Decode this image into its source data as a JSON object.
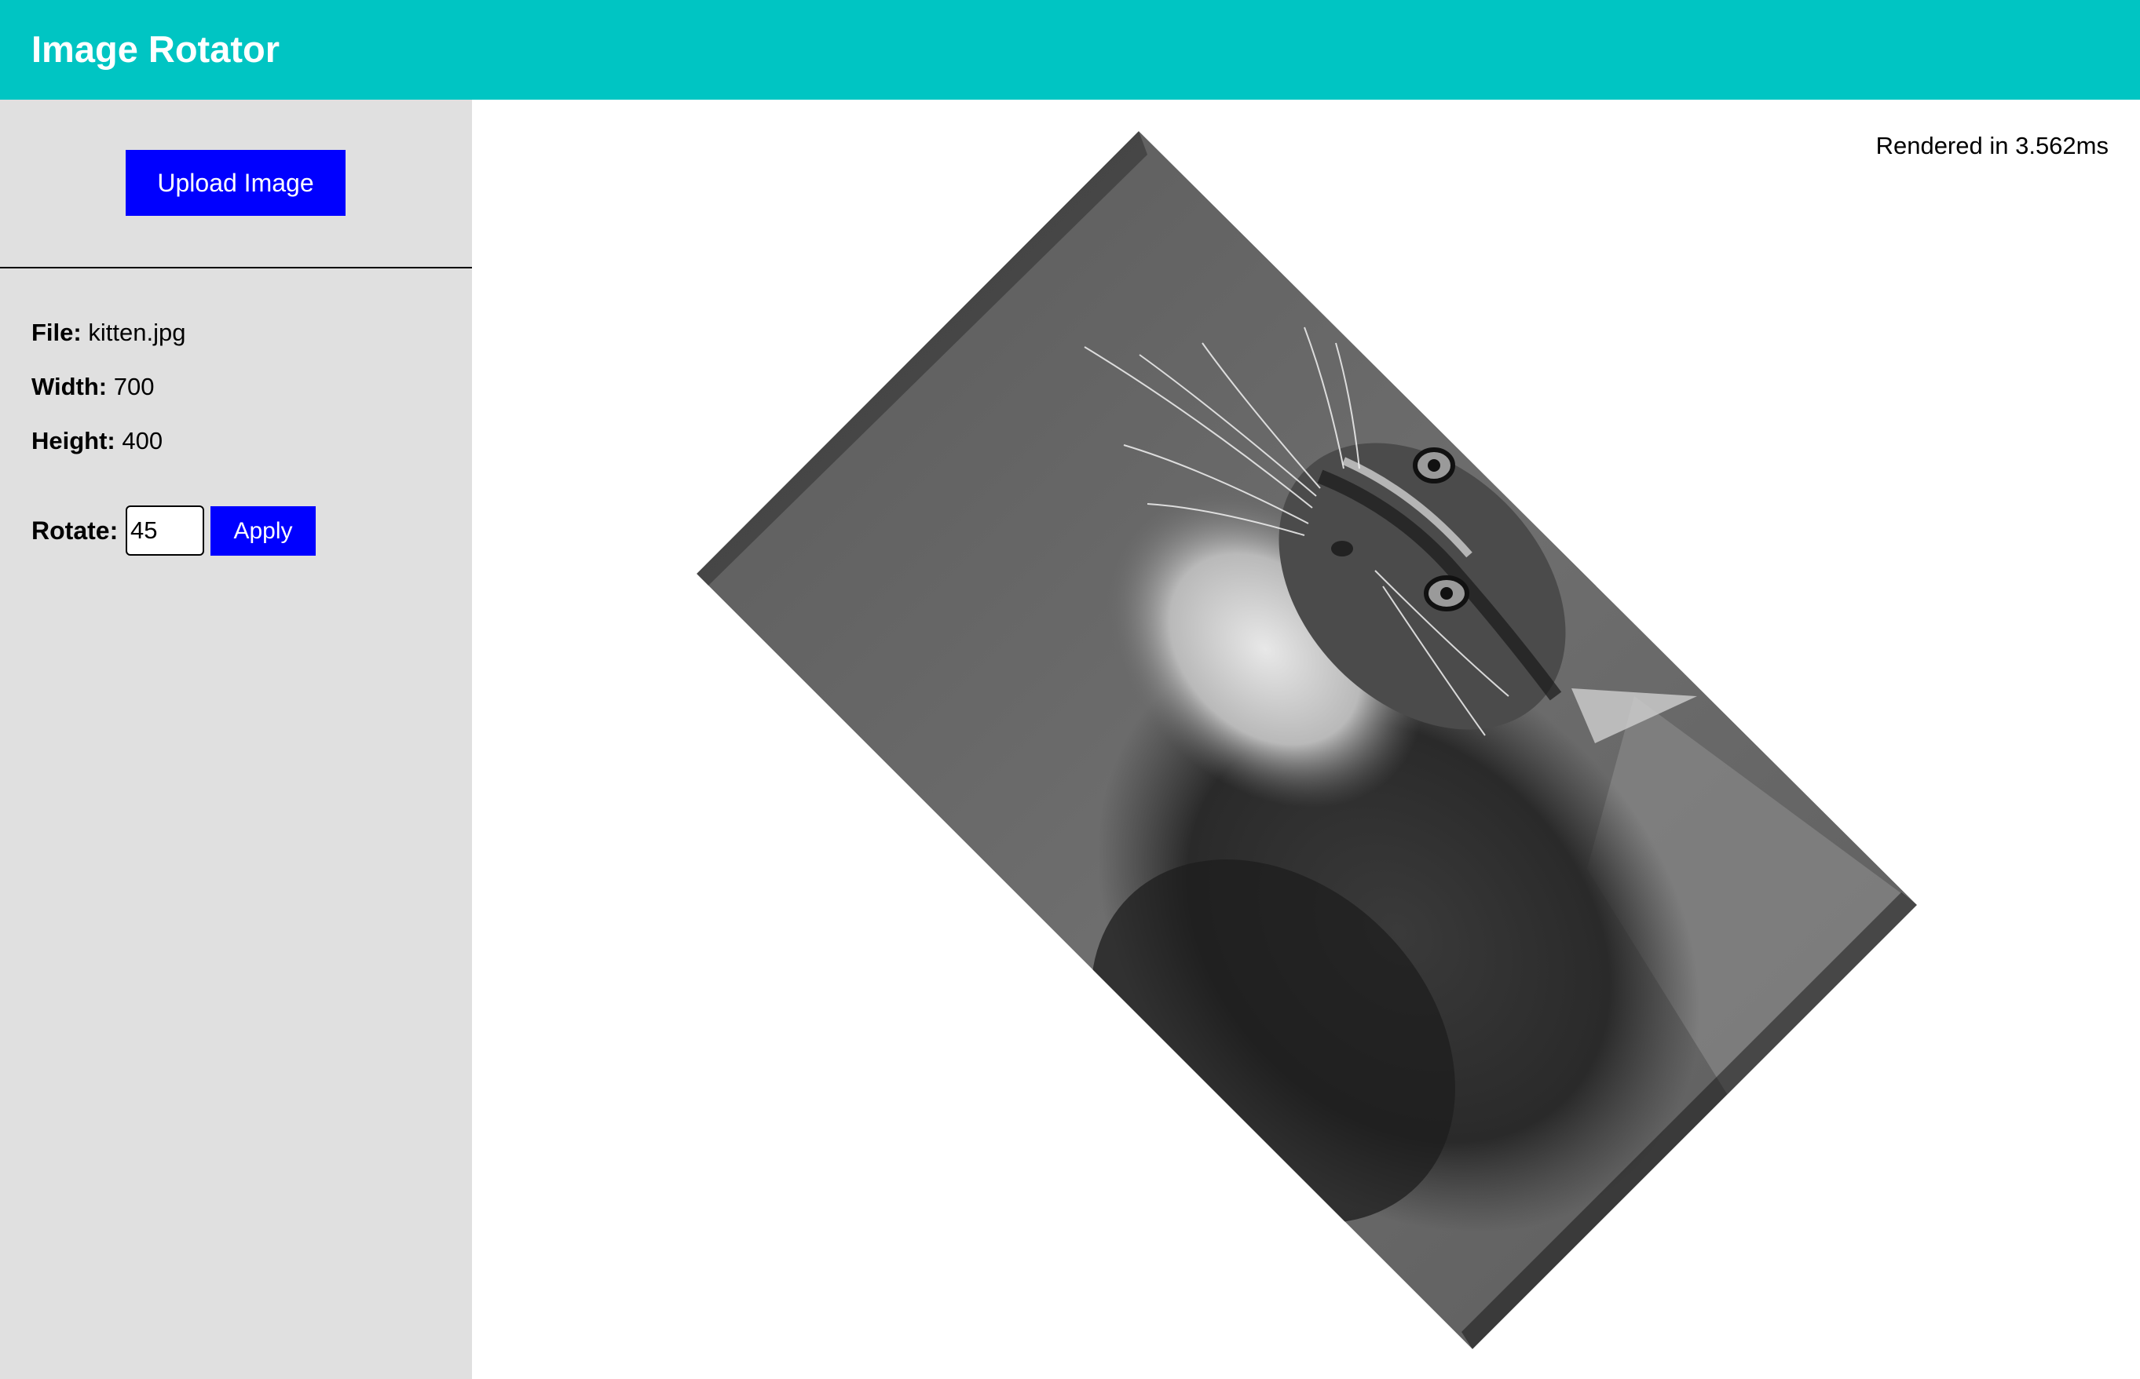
{
  "header": {
    "title": "Image Rotator"
  },
  "sidebar": {
    "upload_label": "Upload Image",
    "file": {
      "label": "File:",
      "value": "kitten.jpg"
    },
    "width": {
      "label": "Width:",
      "value": "700"
    },
    "height": {
      "label": "Height:",
      "value": "400"
    },
    "rotate": {
      "label": "Rotate:",
      "value": "45",
      "apply_label": "Apply"
    }
  },
  "main": {
    "render_time": "Rendered in 3.562ms",
    "image": {
      "subject": "kitten",
      "grayscale": true,
      "rotation_degrees": 45
    }
  },
  "colors": {
    "header_bg": "#00c5c3",
    "sidebar_bg": "#e0e0e0",
    "button_bg": "#0000ff"
  }
}
